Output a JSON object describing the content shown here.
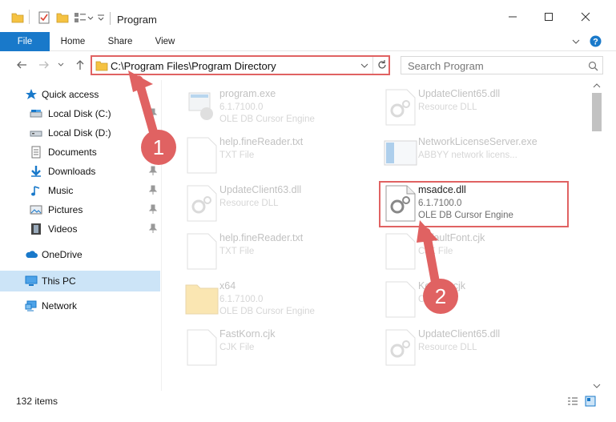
{
  "window": {
    "title": "Program"
  },
  "ribbon": {
    "tabs": [
      "File",
      "Home",
      "Share",
      "View"
    ]
  },
  "address_bar": {
    "path": "C:\\Program Files\\Program Directory"
  },
  "search": {
    "placeholder": "Search Program"
  },
  "nav_pane": {
    "items": [
      {
        "label": "Quick access",
        "icon": "star-icon"
      },
      {
        "label": "Local Disk (C:)",
        "icon": "drive-icon"
      },
      {
        "label": "Local Disk (D:)",
        "icon": "drive-icon"
      },
      {
        "label": "Documents",
        "icon": "documents-icon"
      },
      {
        "label": "Downloads",
        "icon": "download-icon"
      },
      {
        "label": "Music",
        "icon": "music-icon"
      },
      {
        "label": "Pictures",
        "icon": "pictures-icon"
      },
      {
        "label": "Videos",
        "icon": "videos-icon"
      },
      {
        "label": "OneDrive",
        "icon": "cloud-icon"
      },
      {
        "label": "This PC",
        "icon": "pc-icon"
      },
      {
        "label": "Network",
        "icon": "network-icon"
      }
    ]
  },
  "files": [
    {
      "name": "program.exe",
      "line2": "6.1.7100.0",
      "line3": "OLE DB Cursor Engine",
      "icon": "exe-icon"
    },
    {
      "name": "UpdateClient65.dll",
      "line2": "Resource DLL",
      "line3": "",
      "icon": "dll-icon"
    },
    {
      "name": "help.fineReader.txt",
      "line2": "TXT File",
      "line3": "",
      "icon": "txt-icon"
    },
    {
      "name": "NetworkLicenseServer.exe",
      "line2": "ABBYY network licens...",
      "line3": "",
      "icon": "exe-icon"
    },
    {
      "name": "UpdateClient63.dll",
      "line2": "Resource DLL",
      "line3": "",
      "icon": "dll-icon"
    },
    {
      "name": "msadce.dll",
      "line2": "6.1.7100.0",
      "line3": "OLE DB Cursor Engine",
      "icon": "dll-icon"
    },
    {
      "name": "help.fineReader.txt",
      "line2": "TXT File",
      "line3": "",
      "icon": "txt-icon"
    },
    {
      "name": "DefaultFont.cjk",
      "line2": "CJK File",
      "line3": "",
      "icon": "file-icon"
    },
    {
      "name": "x64",
      "line2": "6.1.7100.0",
      "line3": "OLE DB Cursor Engine",
      "icon": "folder-icon"
    },
    {
      "name": "Korean.cjk",
      "line2": "CJK File",
      "line3": "",
      "icon": "file-icon"
    },
    {
      "name": "FastKorn.cjk",
      "line2": "CJK File",
      "line3": "",
      "icon": "file-icon"
    },
    {
      "name": "UpdateClient65.dll",
      "line2": "Resource DLL",
      "line3": "",
      "icon": "dll-icon"
    }
  ],
  "status": {
    "item_count": "132 items"
  },
  "annotations": {
    "step1": "1",
    "step2": "2",
    "highlight_color": "#e06262"
  },
  "colors": {
    "accent": "#1979ca",
    "folder": "#f5c242"
  }
}
